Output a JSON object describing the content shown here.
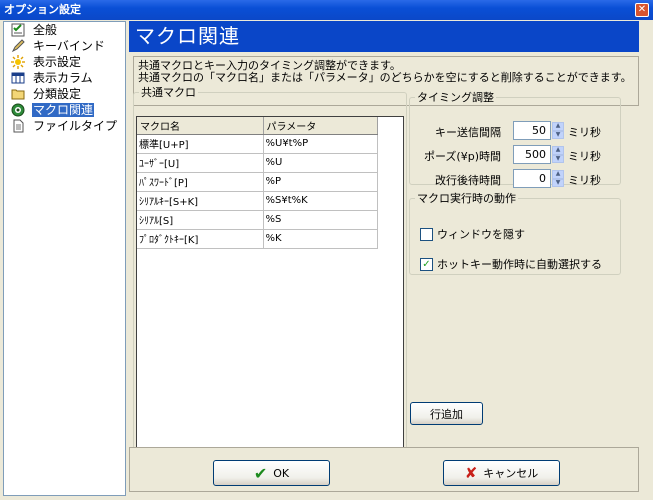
{
  "window": {
    "title": "オプション設定",
    "close_glyph": "✕"
  },
  "sidebar": {
    "items": [
      {
        "label": "全般",
        "icon": "checklist-icon"
      },
      {
        "label": "キーバインド",
        "icon": "pencil-icon"
      },
      {
        "label": "表示設定",
        "icon": "sun-icon"
      },
      {
        "label": "表示カラム",
        "icon": "columns-icon"
      },
      {
        "label": "分類設定",
        "icon": "folder-icon"
      },
      {
        "label": "マクロ関連",
        "icon": "globe-icon",
        "selected": true
      },
      {
        "label": "ファイルタイプ",
        "icon": "document-icon"
      }
    ]
  },
  "header": {
    "title": "マクロ関連"
  },
  "description": {
    "line1": "共通マクロとキー入力のタイミング調整ができます。",
    "line2": "共通マクロの「マクロ名」または「パラメータ」のどちらかを空にすると削除することができます。"
  },
  "macros": {
    "group_label": "共通マクロ",
    "columns": [
      "マクロ名",
      "パラメータ"
    ],
    "rows": [
      {
        "name": "標準[U+P]",
        "param": "%U¥t%P"
      },
      {
        "name": "ﾕｰｻﾞｰ[U]",
        "param": "%U"
      },
      {
        "name": "ﾊﾟｽﾜｰﾄﾞ[P]",
        "param": "%P"
      },
      {
        "name": "ｼﾘｱﾙｷｰ[S+K]",
        "param": "%S¥t%K"
      },
      {
        "name": "ｼﾘｱﾙ[S]",
        "param": "%S"
      },
      {
        "name": "ﾌﾟﾛﾀﾞｸﾄｷｰ[K]",
        "param": "%K"
      }
    ]
  },
  "timing": {
    "group_label": "タイミング調整",
    "unit": "ミリ秒",
    "rows": [
      {
        "label": "キー送信間隔",
        "value": "50"
      },
      {
        "label": "ポーズ(¥p)時間",
        "value": "500"
      },
      {
        "label": "改行後待時間",
        "value": "0"
      }
    ]
  },
  "execution": {
    "group_label": "マクロ実行時の動作",
    "options": [
      {
        "label": "ウィンドウを隠す",
        "checked": false
      },
      {
        "label": "ホットキー動作時に自動選択する",
        "checked": true
      }
    ]
  },
  "buttons": {
    "add_row": "行追加",
    "ok": "OK",
    "cancel": "キャンセル"
  },
  "colors": {
    "header_bg": "#0a46c8",
    "selection": "#316ac5",
    "titlebar": "#0b48c8"
  }
}
